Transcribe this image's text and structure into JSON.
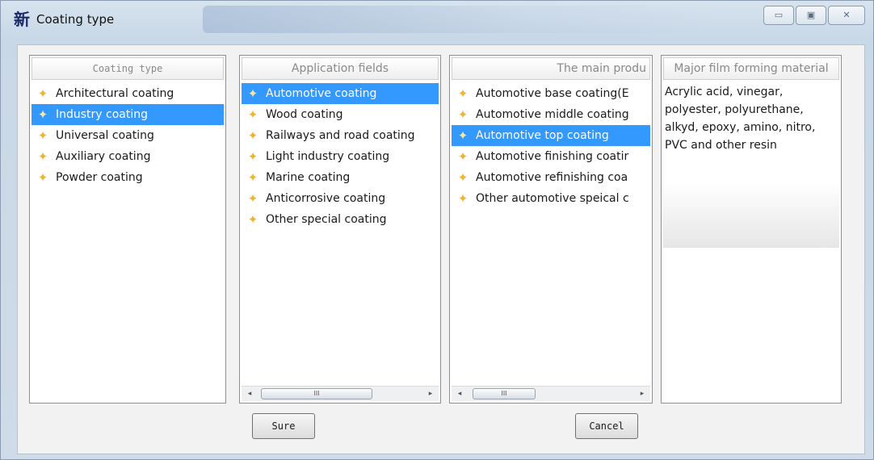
{
  "window": {
    "title": "Coating type",
    "app_icon": "新",
    "controls": {
      "minimize": "▭",
      "maximize": "▣",
      "close": "✕"
    }
  },
  "panels": {
    "coating_type": {
      "header": "Coating type",
      "items": [
        "Architectural coating",
        "Industry coating",
        "Universal coating",
        "Auxiliary coating",
        "Powder coating"
      ],
      "selected_index": 1
    },
    "application_fields": {
      "header": "Application fields",
      "items": [
        "Automotive coating",
        "Wood coating",
        "Railways and road coating",
        "Light industry coating",
        "Marine coating",
        "Anticorrosive coating",
        "Other special coating"
      ],
      "selected_index": 0,
      "scrollbar": {
        "left_arrow": "◂",
        "thumb": "III",
        "right_arrow": "▸"
      }
    },
    "main_products": {
      "header": "The main produ",
      "items": [
        "Automotive base coating(E",
        "Automotive middle coating",
        "Automotive top coating",
        "Automotive finishing coatir",
        "Automotive refinishing coa",
        "Other automotive speical c"
      ],
      "selected_index": 2,
      "scrollbar": {
        "left_arrow": "◂",
        "thumb": "III",
        "right_arrow": "▸"
      }
    },
    "film_material": {
      "header": "Major film forming material",
      "text": "Acrylic acid, vinegar, polyester, polyurethane, alkyd, epoxy, amino, nitro, PVC and other resin"
    }
  },
  "buttons": {
    "sure": "Sure",
    "cancel": "Cancel"
  },
  "icons": {
    "list_item": "star-icon",
    "star_glyph": "✦"
  },
  "colors": {
    "selection": "#3399ff",
    "star": "#f0b62a"
  }
}
